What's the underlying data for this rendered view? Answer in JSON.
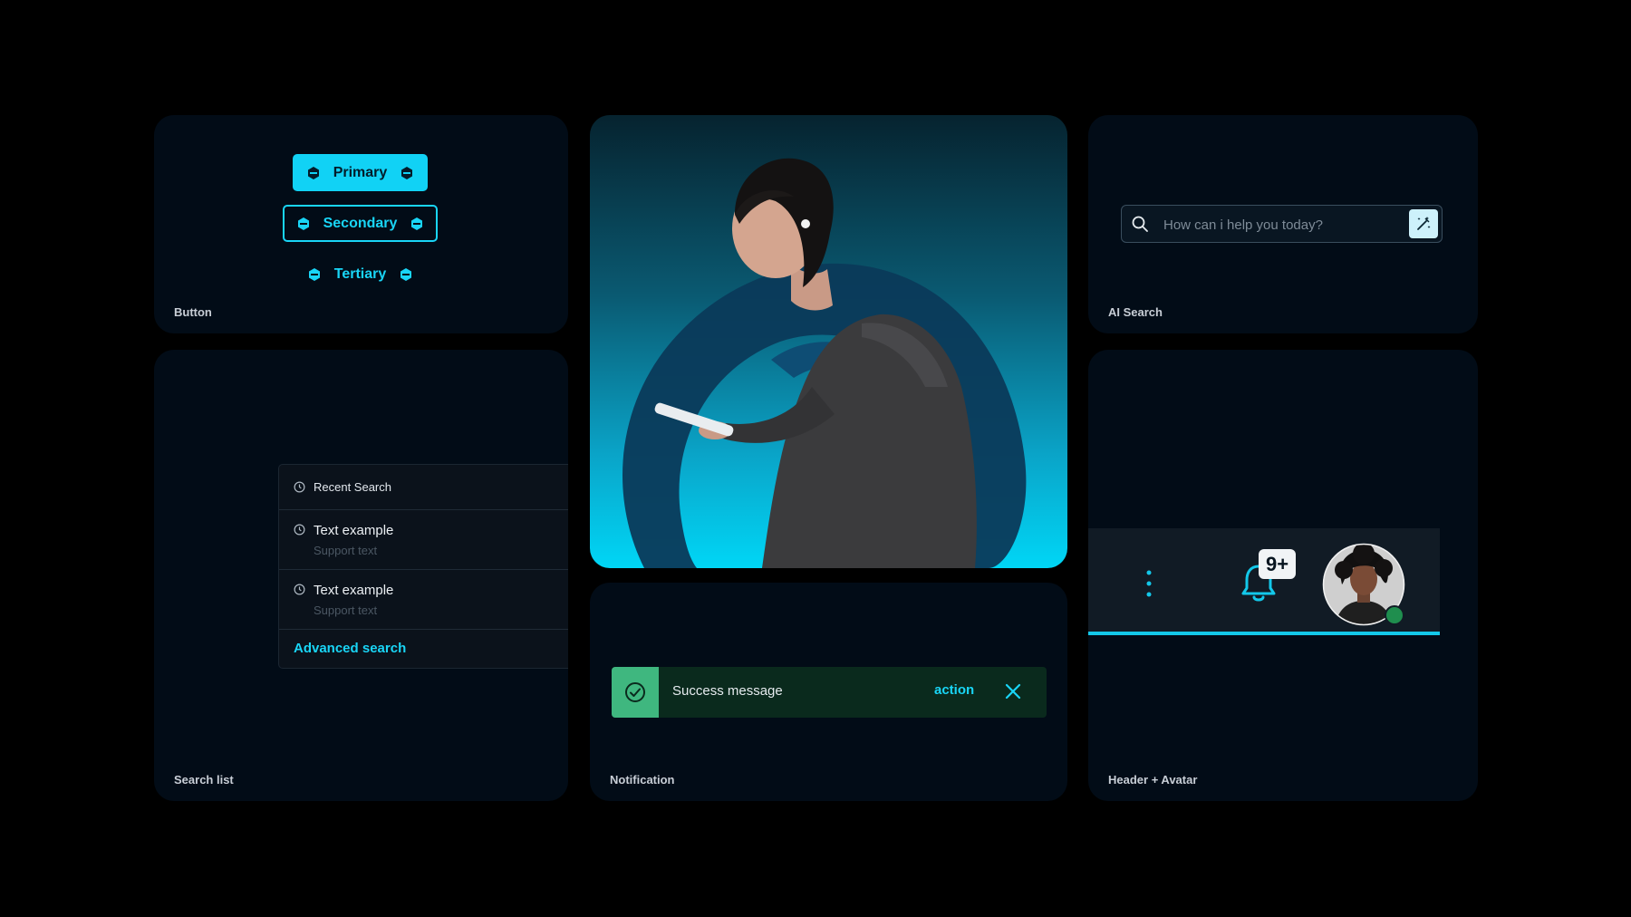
{
  "buttons": {
    "primary_label": "Primary",
    "secondary_label": "Secondary",
    "tertiary_label": "Tertiary",
    "card_label": "Button"
  },
  "ai_search": {
    "placeholder": "How can i help you today?",
    "card_label": "AI Search"
  },
  "search_list": {
    "header": "Recent Search",
    "items": [
      {
        "title": "Text example",
        "support": "Support text"
      },
      {
        "title": "Text example",
        "support": "Support text"
      }
    ],
    "advanced": "Advanced search",
    "card_label": "Search list"
  },
  "notification": {
    "message": "Success message",
    "action": "action",
    "card_label": "Notification"
  },
  "header_avatar": {
    "badge": "9+",
    "card_label": "Header + Avatar"
  },
  "icons": {
    "button_glyph": "hexagon-link-icon",
    "search": "search-icon",
    "magic": "magic-wand-icon",
    "clock": "clock-icon",
    "success": "check-circle-icon",
    "close": "close-icon",
    "menu": "kebab-menu-icon",
    "bell": "bell-icon",
    "avatar": "user-avatar"
  },
  "colors": {
    "accent": "#11d2f5",
    "card_bg": "#020c17",
    "success": "#3fb77f",
    "online": "#1f8e4e"
  }
}
